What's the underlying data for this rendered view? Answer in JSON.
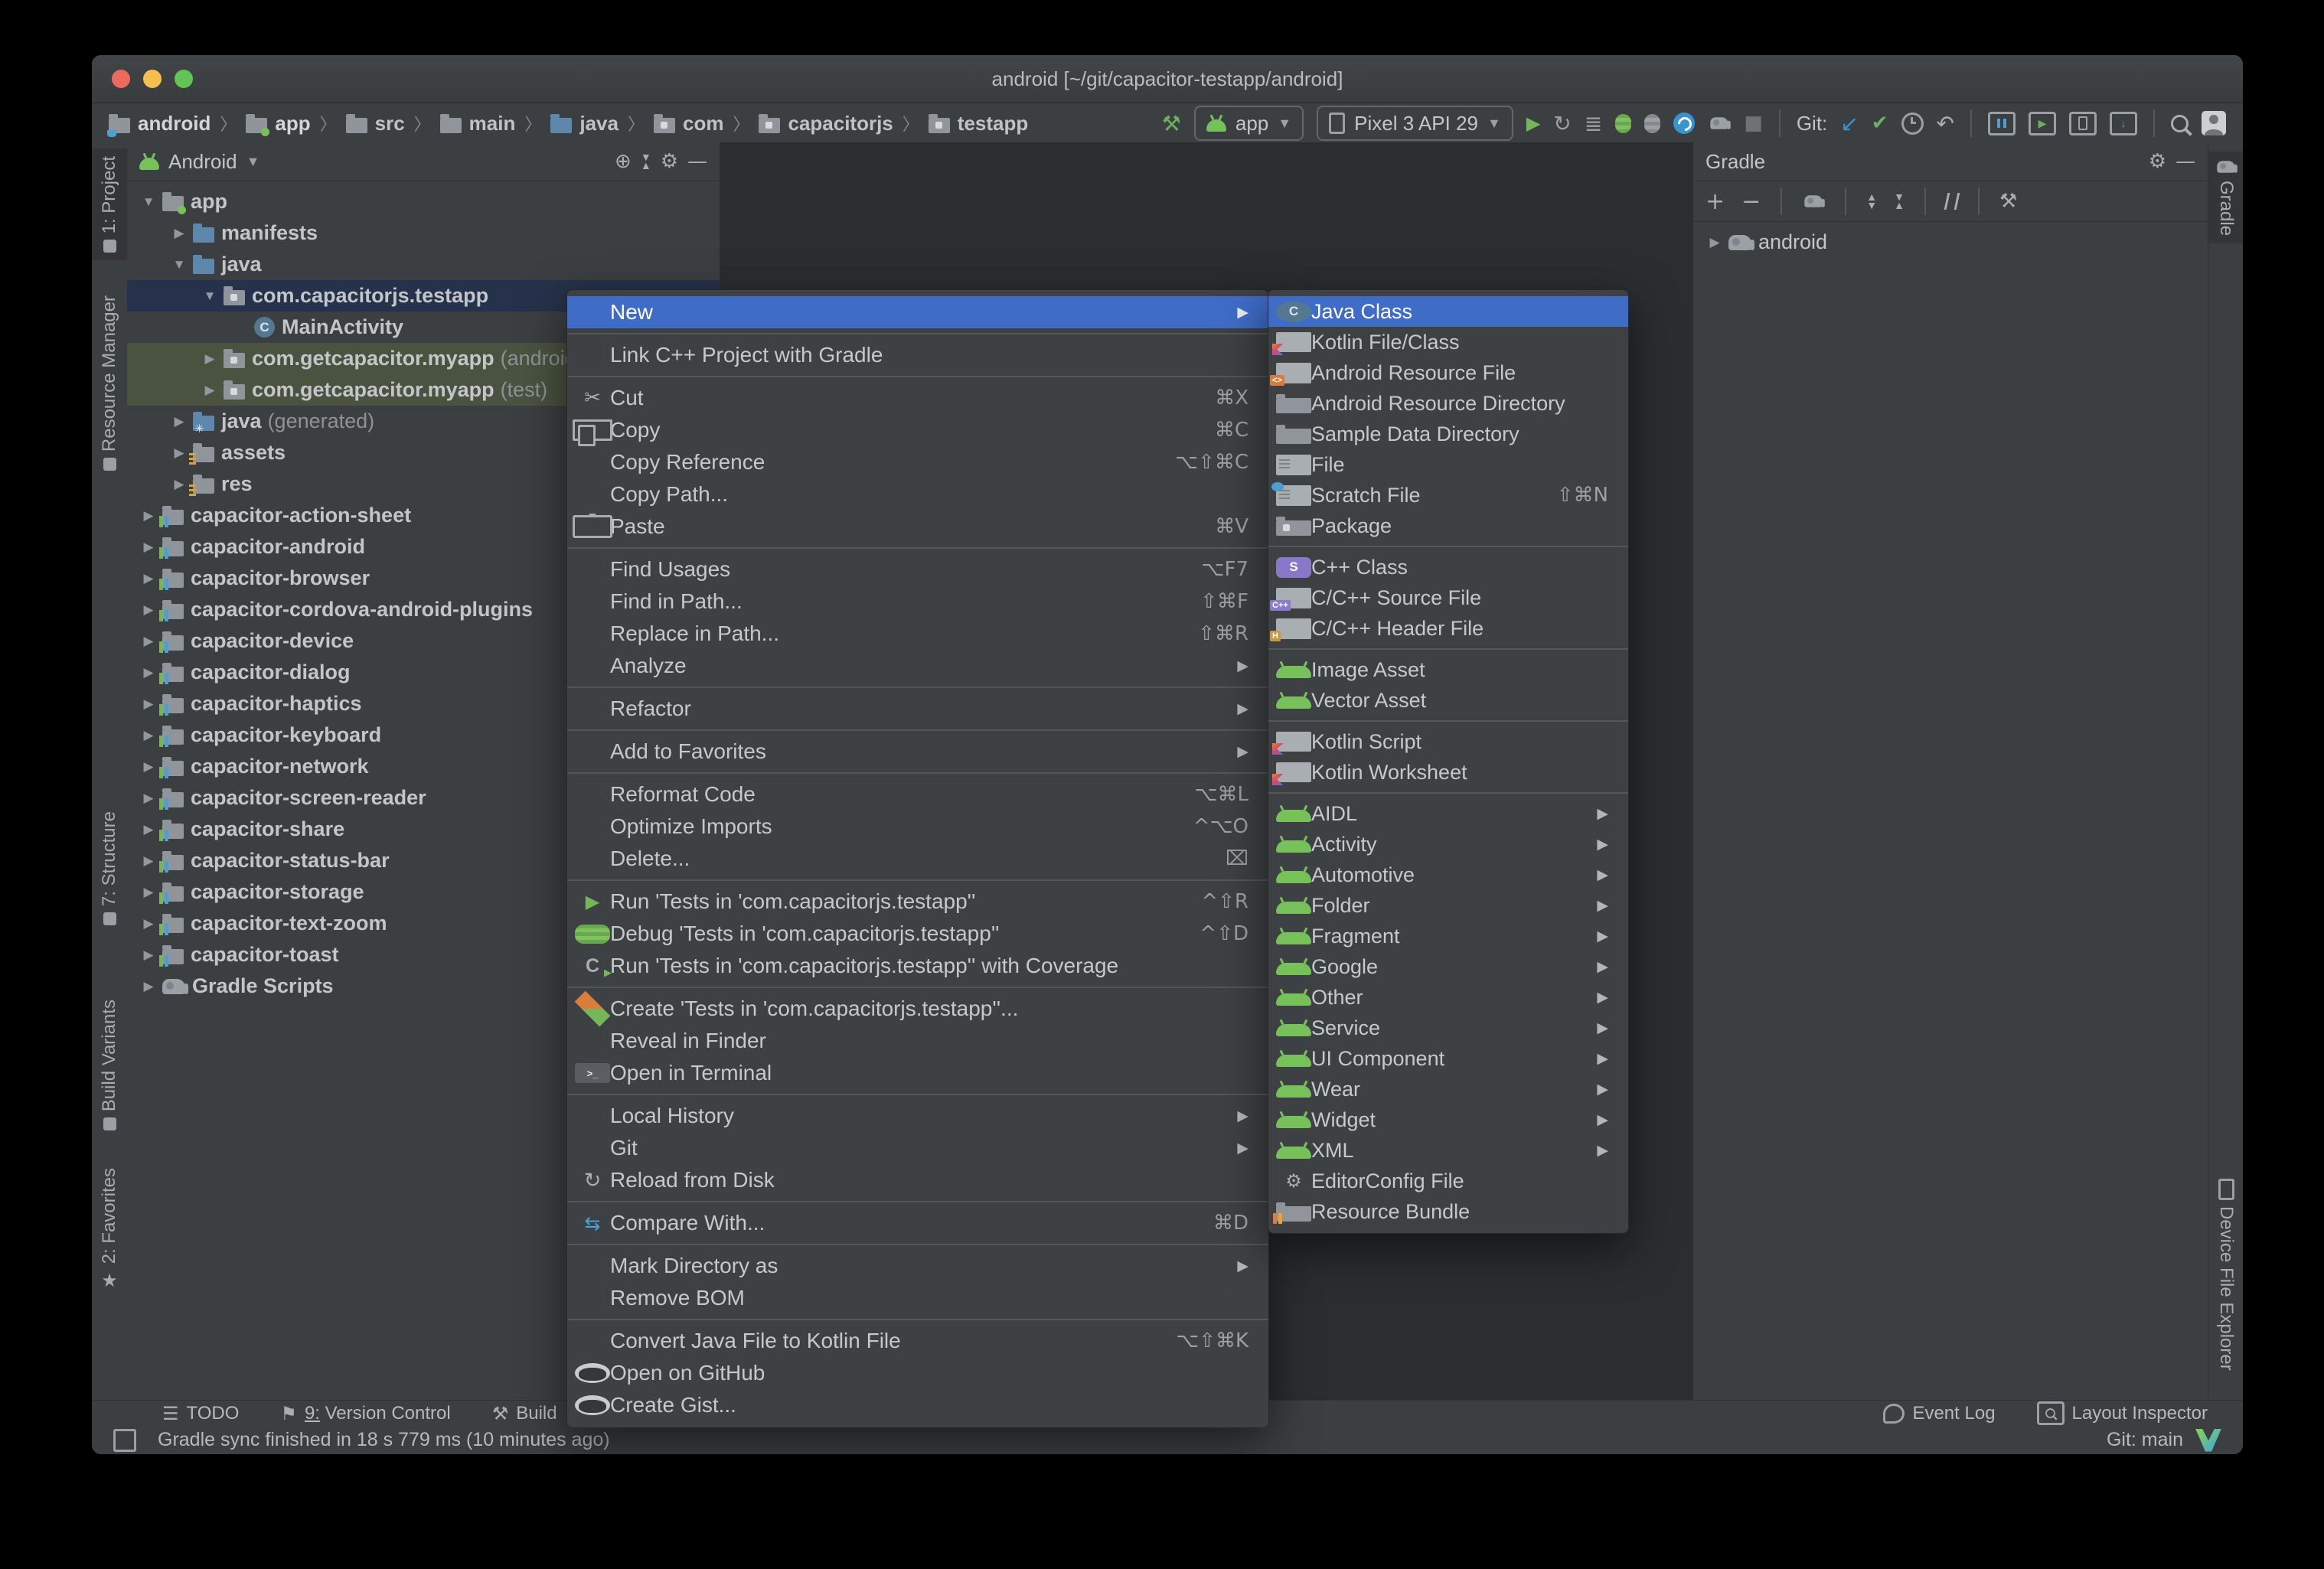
{
  "window": {
    "title": "android [~/git/capacitor-testapp/android]"
  },
  "colors": {
    "selection_blue": "#3f6cc7",
    "tree_selected_row": "#26324b",
    "tree_source_set_row": "#4a5340",
    "run_green": "#77b55a",
    "traffic_red": "#ec6a5e",
    "traffic_yellow": "#f4bf4f",
    "traffic_green": "#61c454"
  },
  "toolbar": {
    "breadcrumbs": [
      {
        "label": "android",
        "icon": "project-folder",
        "bold": true
      },
      {
        "label": "app",
        "icon": "folder-app",
        "bold": true
      },
      {
        "label": "src",
        "icon": "folder"
      },
      {
        "label": "main",
        "icon": "folder"
      },
      {
        "label": "java",
        "icon": "folder-blue"
      },
      {
        "label": "com",
        "icon": "folder-pkg"
      },
      {
        "label": "capacitorjs",
        "icon": "folder-pkg"
      },
      {
        "label": "testapp",
        "icon": "folder-pkg"
      }
    ],
    "run_config": "app",
    "device": "Pixel 3 API 29",
    "git_label": "Git:",
    "actions": [
      {
        "name": "make-project-hammer-icon",
        "kind": "hammer"
      },
      {
        "name": "run-config-combo",
        "kind": "combo-app"
      },
      {
        "name": "device-combo",
        "kind": "combo-device"
      },
      {
        "name": "run-icon",
        "kind": "run"
      },
      {
        "name": "apply-changes-icon",
        "kind": "circ"
      },
      {
        "name": "apply-code-changes-icon",
        "kind": "list"
      },
      {
        "name": "debug-icon",
        "kind": "bug"
      },
      {
        "name": "attach-debugger-icon",
        "kind": "bug-gray"
      },
      {
        "name": "profiler-icon",
        "kind": "prof"
      },
      {
        "name": "sync-project-icon",
        "kind": "eleph-sm"
      },
      {
        "name": "stop-icon",
        "kind": "stop"
      },
      {
        "name": "git-update-icon",
        "kind": "git-update"
      },
      {
        "name": "git-commit-icon",
        "kind": "commit"
      },
      {
        "name": "history-icon",
        "kind": "clock"
      },
      {
        "name": "rollback-icon",
        "kind": "rollback"
      },
      {
        "name": "project-structure-icon",
        "kind": "box-structure"
      },
      {
        "name": "running-devices-icon",
        "kind": "box-run"
      },
      {
        "name": "device-manager-icon",
        "kind": "box-device"
      },
      {
        "name": "sdk-manager-icon",
        "kind": "box-sdk"
      },
      {
        "name": "search-everywhere-icon",
        "kind": "mag"
      },
      {
        "name": "profile-avatar",
        "kind": "avatar"
      }
    ]
  },
  "left_stripe": {
    "top": [
      {
        "label": "1: Project",
        "active": true
      },
      {
        "label": "Resource Manager"
      }
    ],
    "bottom": [
      {
        "label": "7: Structure"
      },
      {
        "label": "Build Variants"
      },
      {
        "label": "2: Favorites"
      }
    ]
  },
  "right_stripe": {
    "top": [
      {
        "label": "Gradle",
        "active": true
      }
    ],
    "bottom": [
      {
        "label": "Device File Explorer"
      }
    ]
  },
  "project_panel": {
    "view_selector": "Android",
    "tree": [
      {
        "label": "app",
        "icon": "folder-app",
        "indent": 0,
        "arrow": "down"
      },
      {
        "label": "manifests",
        "icon": "folder-blue",
        "indent": 1,
        "arrow": "right"
      },
      {
        "label": "java",
        "icon": "folder-blue",
        "indent": 1,
        "arrow": "down"
      },
      {
        "label": "com.capacitorjs.testapp",
        "icon": "folder-pkg",
        "indent": 2,
        "arrow": "down",
        "state": "selected"
      },
      {
        "label": "MainActivity",
        "icon": "class",
        "indent": 3,
        "arrow": "none"
      },
      {
        "label": "com.getcapacitor.myapp",
        "suffix": "(androidTest)",
        "icon": "folder-pkg",
        "indent": 2,
        "arrow": "right",
        "state": "green"
      },
      {
        "label": "com.getcapacitor.myapp",
        "suffix": "(test)",
        "icon": "folder-pkg",
        "indent": 2,
        "arrow": "right",
        "state": "green"
      },
      {
        "label": "java",
        "suffix": "(generated)",
        "icon": "folder-gen",
        "indent": 1,
        "arrow": "right"
      },
      {
        "label": "assets",
        "icon": "folder-assets",
        "indent": 1,
        "arrow": "right"
      },
      {
        "label": "res",
        "icon": "folder-assets",
        "indent": 1,
        "arrow": "right"
      },
      {
        "label": "capacitor-action-sheet",
        "icon": "module",
        "indent": 0,
        "arrow": "right"
      },
      {
        "label": "capacitor-android",
        "icon": "module",
        "indent": 0,
        "arrow": "right"
      },
      {
        "label": "capacitor-browser",
        "icon": "module",
        "indent": 0,
        "arrow": "right"
      },
      {
        "label": "capacitor-cordova-android-plugins",
        "icon": "module",
        "indent": 0,
        "arrow": "right"
      },
      {
        "label": "capacitor-device",
        "icon": "module",
        "indent": 0,
        "arrow": "right"
      },
      {
        "label": "capacitor-dialog",
        "icon": "module",
        "indent": 0,
        "arrow": "right"
      },
      {
        "label": "capacitor-haptics",
        "icon": "module",
        "indent": 0,
        "arrow": "right"
      },
      {
        "label": "capacitor-keyboard",
        "icon": "module",
        "indent": 0,
        "arrow": "right"
      },
      {
        "label": "capacitor-network",
        "icon": "module",
        "indent": 0,
        "arrow": "right"
      },
      {
        "label": "capacitor-screen-reader",
        "icon": "module",
        "indent": 0,
        "arrow": "right"
      },
      {
        "label": "capacitor-share",
        "icon": "module",
        "indent": 0,
        "arrow": "right"
      },
      {
        "label": "capacitor-status-bar",
        "icon": "module",
        "indent": 0,
        "arrow": "right"
      },
      {
        "label": "capacitor-storage",
        "icon": "module",
        "indent": 0,
        "arrow": "right"
      },
      {
        "label": "capacitor-text-zoom",
        "icon": "module",
        "indent": 0,
        "arrow": "right"
      },
      {
        "label": "capacitor-toast",
        "icon": "module",
        "indent": 0,
        "arrow": "right"
      },
      {
        "label": "Gradle Scripts",
        "icon": "gradle",
        "indent": 0,
        "arrow": "right"
      }
    ]
  },
  "context_menu": {
    "items": [
      {
        "label": "New",
        "submenu": true,
        "highlighted": true
      },
      {
        "sep": true
      },
      {
        "label": "Link C++ Project with Gradle"
      },
      {
        "sep": true
      },
      {
        "label": "Cut",
        "shortcut": "⌘X",
        "icon": "scissors"
      },
      {
        "label": "Copy",
        "shortcut": "⌘C",
        "icon": "copy"
      },
      {
        "label": "Copy Reference",
        "shortcut": "⌥⇧⌘C"
      },
      {
        "label": "Copy Path..."
      },
      {
        "label": "Paste",
        "shortcut": "⌘V",
        "icon": "clipboard"
      },
      {
        "sep": true
      },
      {
        "label": "Find Usages",
        "shortcut": "⌥F7"
      },
      {
        "label": "Find in Path...",
        "shortcut": "⇧⌘F"
      },
      {
        "label": "Replace in Path...",
        "shortcut": "⇧⌘R"
      },
      {
        "label": "Analyze",
        "submenu": true
      },
      {
        "sep": true
      },
      {
        "label": "Refactor",
        "submenu": true
      },
      {
        "sep": true
      },
      {
        "label": "Add to Favorites",
        "submenu": true
      },
      {
        "sep": true
      },
      {
        "label": "Reformat Code",
        "shortcut": "⌥⌘L"
      },
      {
        "label": "Optimize Imports",
        "shortcut": "^⌥O"
      },
      {
        "label": "Delete...",
        "shortcut": "⌧"
      },
      {
        "sep": true
      },
      {
        "label": "Run 'Tests in 'com.capacitorjs.testapp''",
        "shortcut": "^⇧R",
        "icon": "run"
      },
      {
        "label": "Debug 'Tests in 'com.capacitorjs.testapp''",
        "shortcut": "^⇧D",
        "icon": "bug"
      },
      {
        "label": "Run 'Tests in 'com.capacitorjs.testapp'' with Coverage",
        "icon": "coverage"
      },
      {
        "sep": true
      },
      {
        "label": "Create 'Tests in 'com.capacitorjs.testapp''...",
        "icon": "create-test"
      },
      {
        "label": "Reveal in Finder"
      },
      {
        "label": "Open in Terminal",
        "icon": "terminal"
      },
      {
        "sep": true
      },
      {
        "label": "Local History",
        "submenu": true
      },
      {
        "label": "Git",
        "submenu": true
      },
      {
        "label": "Reload from Disk",
        "icon": "reload"
      },
      {
        "sep": true
      },
      {
        "label": "Compare With...",
        "shortcut": "⌘D",
        "icon": "compare"
      },
      {
        "sep": true
      },
      {
        "label": "Mark Directory as",
        "submenu": true
      },
      {
        "label": "Remove BOM"
      },
      {
        "sep": true
      },
      {
        "label": "Convert Java File to Kotlin File",
        "shortcut": "⌥⇧⌘K"
      },
      {
        "label": "Open on GitHub",
        "icon": "github"
      },
      {
        "label": "Create Gist...",
        "icon": "github"
      }
    ]
  },
  "new_submenu": {
    "items": [
      {
        "label": "Java Class",
        "icon": "class",
        "highlighted": true
      },
      {
        "label": "Kotlin File/Class",
        "icon": "kotlin"
      },
      {
        "label": "Android Resource File",
        "icon": "res-file"
      },
      {
        "label": "Android Resource Directory",
        "icon": "folder"
      },
      {
        "label": "Sample Data Directory",
        "icon": "folder"
      },
      {
        "label": "File",
        "icon": "file"
      },
      {
        "label": "Scratch File",
        "shortcut": "⇧⌘N",
        "icon": "scratch"
      },
      {
        "label": "Package",
        "icon": "folder-pkg"
      },
      {
        "sep": true
      },
      {
        "label": "C++ Class",
        "icon": "cpp-class"
      },
      {
        "label": "C/C++ Source File",
        "icon": "cpp-src"
      },
      {
        "label": "C/C++ Header File",
        "icon": "cpp-hdr"
      },
      {
        "sep": true
      },
      {
        "label": "Image Asset",
        "icon": "android"
      },
      {
        "label": "Vector Asset",
        "icon": "android"
      },
      {
        "sep": true
      },
      {
        "label": "Kotlin Script",
        "icon": "kotlin"
      },
      {
        "label": "Kotlin Worksheet",
        "icon": "kotlin"
      },
      {
        "sep": true
      },
      {
        "label": "AIDL",
        "icon": "android",
        "submenu": true
      },
      {
        "label": "Activity",
        "icon": "android",
        "submenu": true
      },
      {
        "label": "Automotive",
        "icon": "android",
        "submenu": true
      },
      {
        "label": "Folder",
        "icon": "android",
        "submenu": true
      },
      {
        "label": "Fragment",
        "icon": "android",
        "submenu": true
      },
      {
        "label": "Google",
        "icon": "android",
        "submenu": true
      },
      {
        "label": "Other",
        "icon": "android",
        "submenu": true
      },
      {
        "label": "Service",
        "icon": "android",
        "submenu": true
      },
      {
        "label": "UI Component",
        "icon": "android",
        "submenu": true
      },
      {
        "label": "Wear",
        "icon": "android",
        "submenu": true
      },
      {
        "label": "Widget",
        "icon": "android",
        "submenu": true
      },
      {
        "label": "XML",
        "icon": "android",
        "submenu": true
      },
      {
        "label": "EditorConfig File",
        "icon": "gear"
      },
      {
        "label": "Resource Bundle",
        "icon": "bundle"
      }
    ]
  },
  "gradle_panel": {
    "title": "Gradle",
    "tree": [
      {
        "label": "android",
        "icon": "gradle",
        "arrow": "right"
      }
    ]
  },
  "bottom_bar": {
    "left": [
      {
        "label": "TODO",
        "icon": "todo"
      },
      {
        "label": "9: Version Control",
        "icon": "flag",
        "mnemonic": true
      },
      {
        "label": "Build",
        "icon": "hammer-gray"
      }
    ],
    "right": [
      {
        "label": "Event Log",
        "icon": "bubble"
      },
      {
        "label": "Layout Inspector",
        "icon": "layout-inspector"
      }
    ]
  },
  "status_bar": {
    "message": "Gradle sync finished in 18 s 779 ms (10 minutes ago)",
    "git_branch": "Git: main"
  }
}
